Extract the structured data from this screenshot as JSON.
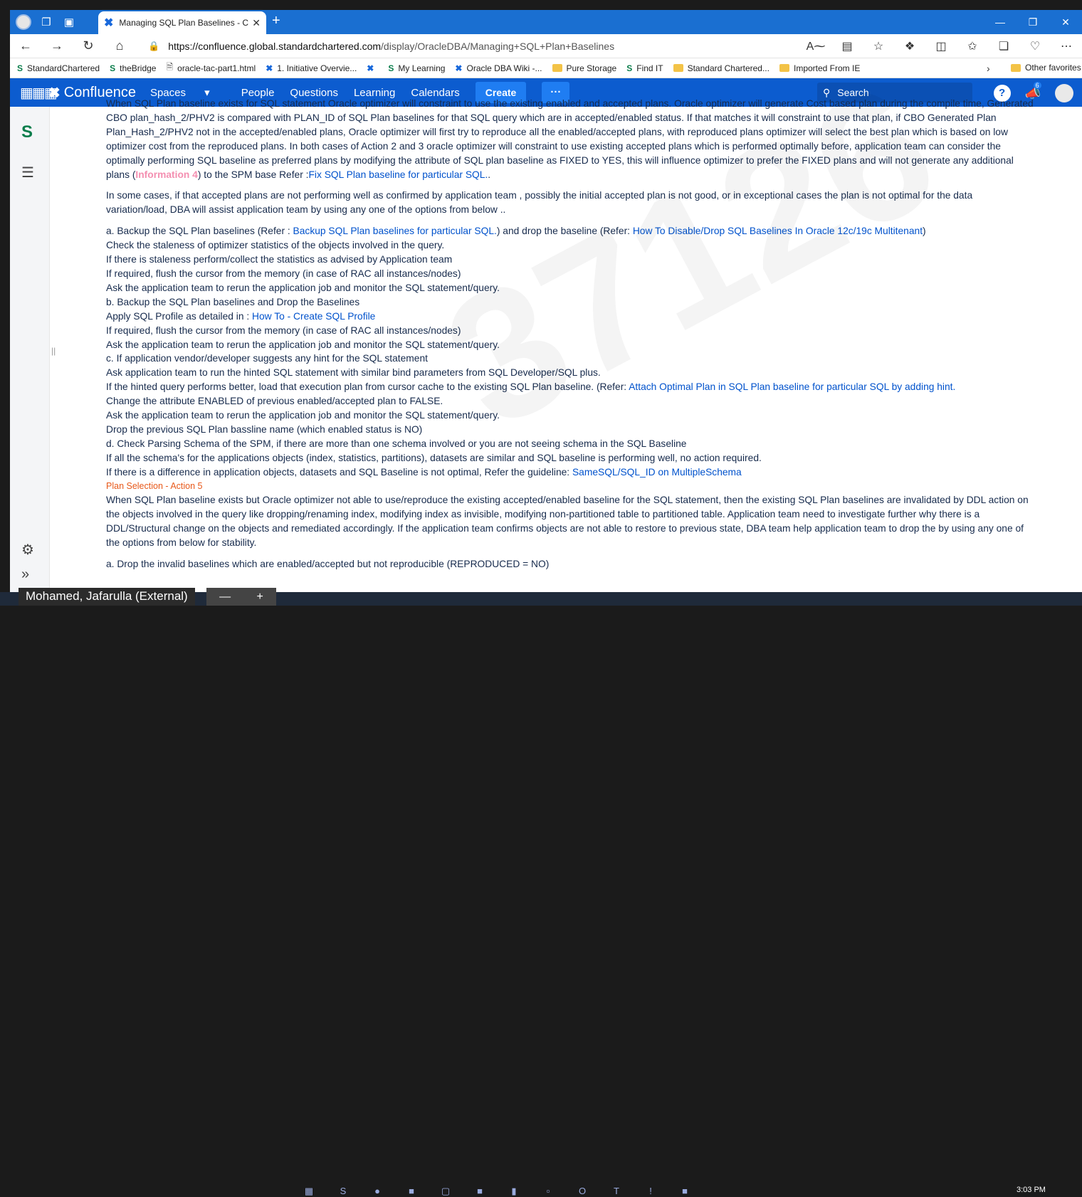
{
  "browser": {
    "tab_title": "Managing SQL Plan Baselines - C",
    "url_host": "https://confluence.global.standardchartered.com",
    "url_path": "/display/OracleDBA/Managing+SQL+Plan+Baselines"
  },
  "bookmarks": [
    {
      "icon": "sc-icon",
      "label": "StandardChartered"
    },
    {
      "icon": "sc-icon",
      "label": "theBridge"
    },
    {
      "icon": "file-icon",
      "label": "oracle-tac-part1.html"
    },
    {
      "icon": "confluence-icon",
      "label": "1. Initiative Overvie..."
    },
    {
      "icon": "confluence-icon",
      "label": ""
    },
    {
      "icon": "sc-icon",
      "label": "My Learning"
    },
    {
      "icon": "confluence-icon",
      "label": "Oracle DBA Wiki -..."
    },
    {
      "icon": "folder-icon",
      "label": "Pure Storage"
    },
    {
      "icon": "sc-icon",
      "label": "Find IT"
    },
    {
      "icon": "folder-icon",
      "label": "Standard Chartered..."
    },
    {
      "icon": "folder-icon",
      "label": "Imported From IE"
    }
  ],
  "bookmarks_other": "Other favorites",
  "confluence": {
    "logo_text": "Confluence",
    "nav": [
      "Spaces",
      "People",
      "Questions",
      "Learning",
      "Calendars"
    ],
    "create_label": "Create",
    "more_label": "···",
    "search_placeholder": "Search",
    "notif_count": "6"
  },
  "content": {
    "p1_top": "When SQL Plan baseline exists for SQL statement Oracle optimizer will constraint to use the existing enabled and accepted plans. Oracle optimizer will generate Cost based plan during the compile time, Generated",
    "p1_l2": "CBO plan_hash_2/PHV2 is compared with PLAN_ID of SQL Plan baselines for that SQL query which are in accepted/enabled status. If that matches it will constraint to use that plan, if CBO Generated Plan",
    "p1_l3": "Plan_Hash_2/PHV2 not in the accepted/enabled plans, Oracle optimizer will first try to reproduce all the enabled/accepted plans, with reproduced plans optimizer will select the best plan which is based on low",
    "p1_l4": "optimizer cost from the reproduced plans.  In both cases of Action 2 and 3 oracle optimizer will constraint to use existing accepted plans which is performed optimally before, application team can consider the",
    "p1_l5": "optimally performing SQL baseline as preferred plans by modifying the attribute of SQL plan baseline as FIXED to YES, this will influence optimizer to prefer the FIXED plans and will not generate any additional",
    "p1_l6_a": "plans (",
    "p1_info4": "Information 4",
    "p1_l6_b": ") to the SPM base Refer :",
    "p1_link": "Fix SQL Plan baseline for particular SQL.",
    "p1_l6_c": ".",
    "p2_l1": "In some cases, if that accepted plans are not performing well as confirmed by application team , possibly the initial accepted plan is not good, or in exceptional cases the plan is not optimal for the data",
    "p2_l2": "variation/load, DBA will assist application team by using any one of the options from  below ..",
    "a_pre": "a. Backup the SQL Plan baselines (Refer : ",
    "a_link1": "Backup SQL Plan baselines for particular SQL.",
    "a_mid": ") and drop the baseline (Refer: ",
    "a_link2": "How To Disable/Drop SQL Baselines In Oracle 12c/19c Multitenant",
    "a_end": ")",
    "a_s1": "Check the staleness of optimizer statistics of the objects involved in the query.",
    "a_s2": "If there is staleness perform/collect the statistics as advised by Application team",
    "a_s3": "If required, flush the cursor from the memory (in case of RAC all instances/nodes)",
    "a_s4": "Ask the application team to rerun the application job and monitor the SQL statement/query.",
    "b_title": "b. Backup the SQL Plan baselines and Drop the Baselines",
    "b_s1_pre": "Apply SQL Profile as detailed in : ",
    "b_s1_link": "How To - Create SQL Profile",
    "b_s2": "If required, flush the cursor from the memory (in case of RAC all instances/nodes)",
    "b_s3": "Ask the application team to rerun the application job and monitor the SQL statement/query.",
    "c_title": "c. If application vendor/developer suggests any hint for the SQL statement",
    "c_s1": "Ask application team to run the hinted SQL statement with similar bind parameters from SQL Developer/SQL plus.",
    "c_s2_pre": "If the hinted query performs better, load that execution plan from cursor cache to the existing SQL Plan baseline. (Refer: ",
    "c_s2_link": "Attach Optimal Plan in SQL Plan baseline for particular SQL by adding hint.",
    "c_s3": "Change the attribute ENABLED of previous enabled/accepted plan to FALSE.",
    "c_s4": "Ask the application team to rerun the application job and monitor the SQL statement/query.",
    "c_s5": "Drop the previous SQL Plan bassline name (which enabled status is NO)",
    "d_title": "d. Check Parsing Schema of the SPM, if there are more than one schema involved or you are not seeing schema in the  SQL Baseline",
    "d_s1": "If all the schema's for the applications objects (index, statistics, partitions), datasets are similar and SQL baseline is performing well, no action required.",
    "d_s2_pre": "If there is a difference in application objects, datasets and SQL Baseline is not optimal, Refer the guideline: ",
    "d_s2_link": "SameSQL/SQL_ID on MultipleSchema",
    "section_heading": "Plan Selection - Action 5",
    "p3_l1": " When SQL Plan baseline exists but Oracle optimizer not able to use/reproduce the existing accepted/enabled baseline for the SQL statement, then the existing SQL Plan baselines are invalidated by DDL action on",
    "p3_l2": "the objects involved in the query like dropping/renaming index, modifying index as invisible, modifying non-partitioned table to partitioned table.   Application team need to investigate further why there is a",
    "p3_l3": "DDL/Structural change on the objects and remediated accordingly. If the application team confirms objects are not able to restore to previous state, DBA team help application team to drop the by using any one of",
    "p3_l4": "the options from below for stability.",
    "p3_cut": "a. Drop the invalid baselines which are enabled/accepted but not reproducible (REPRODUCED = NO)"
  },
  "taskbar": {
    "user_chip": "Mohamed, Jafarulla (External)",
    "clock": "3:03 PM"
  }
}
